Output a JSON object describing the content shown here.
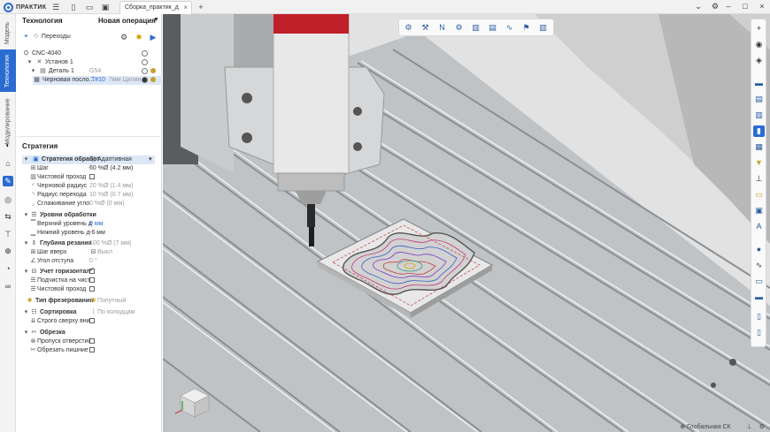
{
  "app": {
    "name": "ПРАКТИК"
  },
  "tabs": [
    {
      "label": "Сборка_практик_д"
    }
  ],
  "left_tabs": [
    "Модель",
    "Технология",
    "Моделирование"
  ],
  "panel": {
    "title": "Технология",
    "new_operation": "Новая операция",
    "transitions": "Переходы",
    "tree": [
      {
        "label": "CNC-4040",
        "extra": ""
      },
      {
        "label": "Установ 1",
        "extra": ""
      },
      {
        "label": "Деталь 1",
        "extra": "G54"
      },
      {
        "label": "Черновая посло...",
        "extra": "T#10",
        "extra2": "7мм Цилинд"
      }
    ]
  },
  "strategy": {
    "title": "Стратегия",
    "main_label": "Стратегия обработ",
    "main_value": "Адаптивная",
    "params": [
      {
        "label": "Шаг",
        "value": "60 %Ø (4.2 мм)",
        "muted": false
      },
      {
        "label": "Чистовой проход",
        "value": "",
        "muted": false
      },
      {
        "label": "Черновой радиус",
        "value": "20 %Ø (1.4 мм)",
        "muted": true
      },
      {
        "label": "Радиус перехода",
        "value": "10 %Ø (0.7 мм)",
        "muted": true
      },
      {
        "label": "Сглаживание угло",
        "value": "0 %Ø (0 мм)",
        "muted": true
      }
    ],
    "levels": {
      "title": "Уровни обработки",
      "items": [
        {
          "label": "Верхний уровень д",
          "value": "0 мм"
        },
        {
          "label": "Нижний уровень д",
          "value": "-6 мм"
        }
      ]
    },
    "depth": {
      "title": "Глубина резания",
      "value": "100 %Ø (7 мм)",
      "items": [
        {
          "label": "Шаг вверх",
          "value": "Выкл"
        },
        {
          "label": "Угол отступа",
          "value": "0 °"
        }
      ]
    },
    "horizontal": {
      "title": "Учет горизонталь",
      "items": [
        "Подчистка на чист",
        "Чистовой проход"
      ]
    },
    "milling_type": {
      "label": "Тип фрезерования",
      "value": "Попутный"
    },
    "sorting": {
      "title": "Сортировка",
      "value": "По колодцам",
      "items": [
        "Строго сверху вни"
      ]
    },
    "trimming": {
      "title": "Обрезка",
      "items": [
        "Пропуск отверстий",
        "Обрезать пишние"
      ]
    }
  },
  "status": {
    "cs": "Глобальная СК"
  }
}
